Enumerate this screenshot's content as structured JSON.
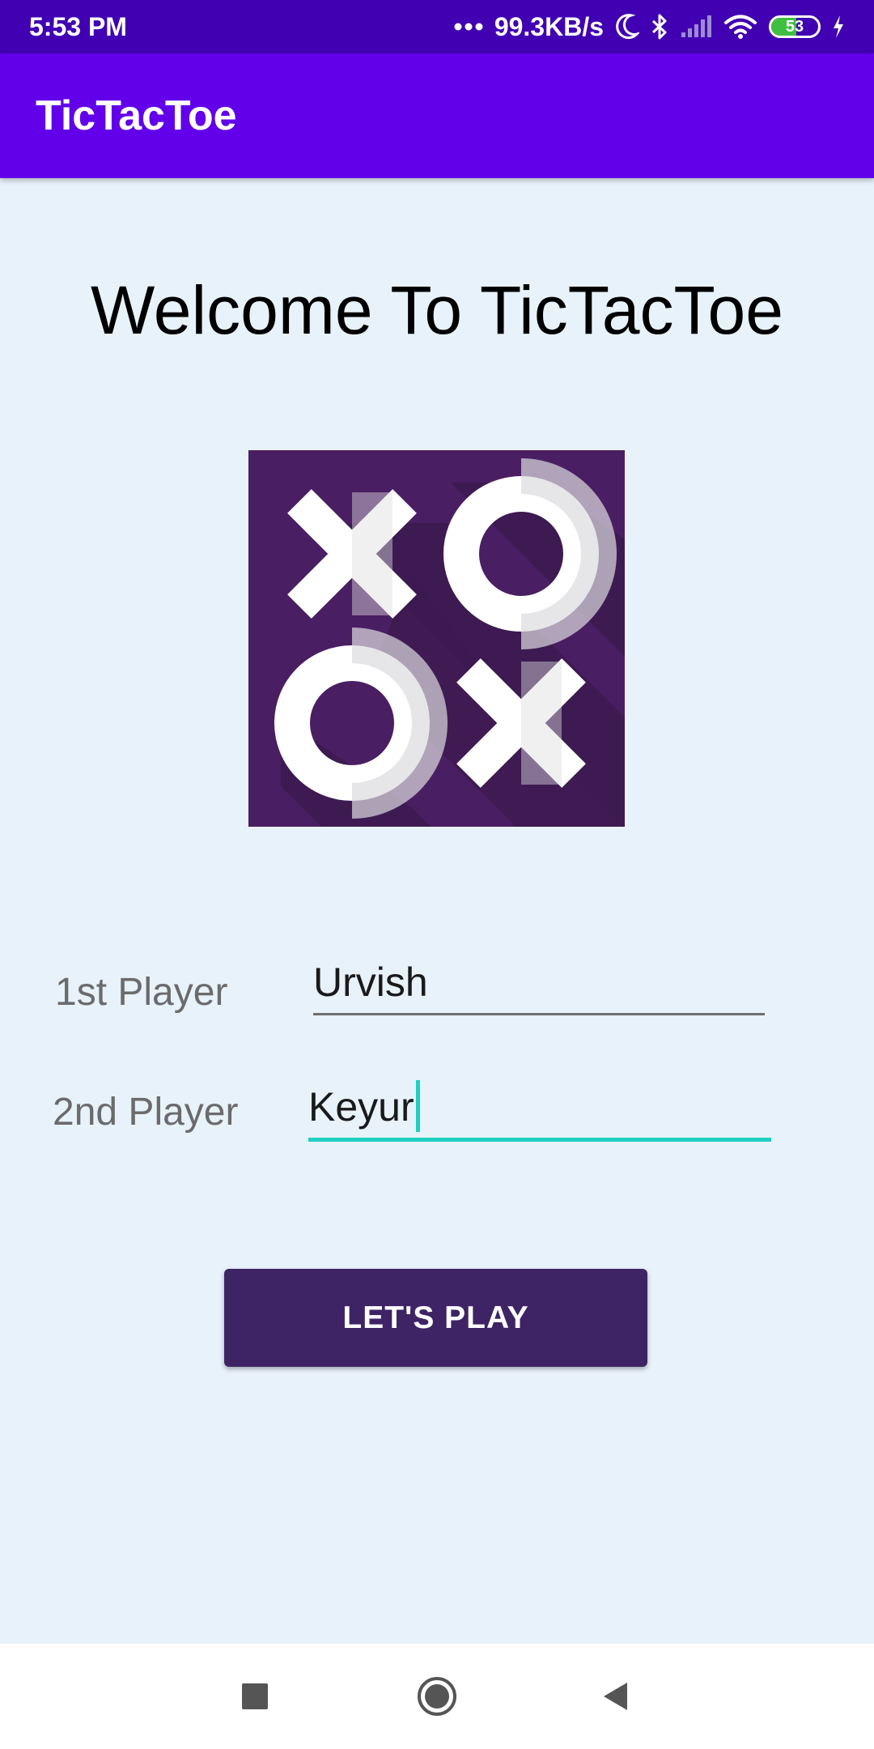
{
  "status_bar": {
    "time": "5:53 PM",
    "net_speed": "99.3KB/s",
    "battery_percent": 53,
    "battery_label": "53",
    "icons": [
      "moon-icon",
      "bluetooth-icon",
      "signal-icon",
      "wifi-icon",
      "battery-icon",
      "charging-icon"
    ]
  },
  "app_bar": {
    "title": "TicTacToe"
  },
  "main": {
    "welcome_text": "Welcome To TicTacToe",
    "logo_icon": "tictactoe-logo-icon",
    "player1": {
      "label": "1st Player",
      "value": "Urvish"
    },
    "player2": {
      "label": "2nd Player",
      "value": "Keyur"
    },
    "play_button_label": "LET'S PLAY"
  },
  "nav_bar": {
    "icons": [
      "recents-icon",
      "home-icon",
      "back-icon"
    ]
  },
  "colors": {
    "status_bar": "#4100b2",
    "app_bar": "#6200ea",
    "background": "#e8f2fa",
    "button": "#3e2465",
    "focus_accent": "#1ecfc2",
    "logo_bg": "#4a1e62"
  }
}
